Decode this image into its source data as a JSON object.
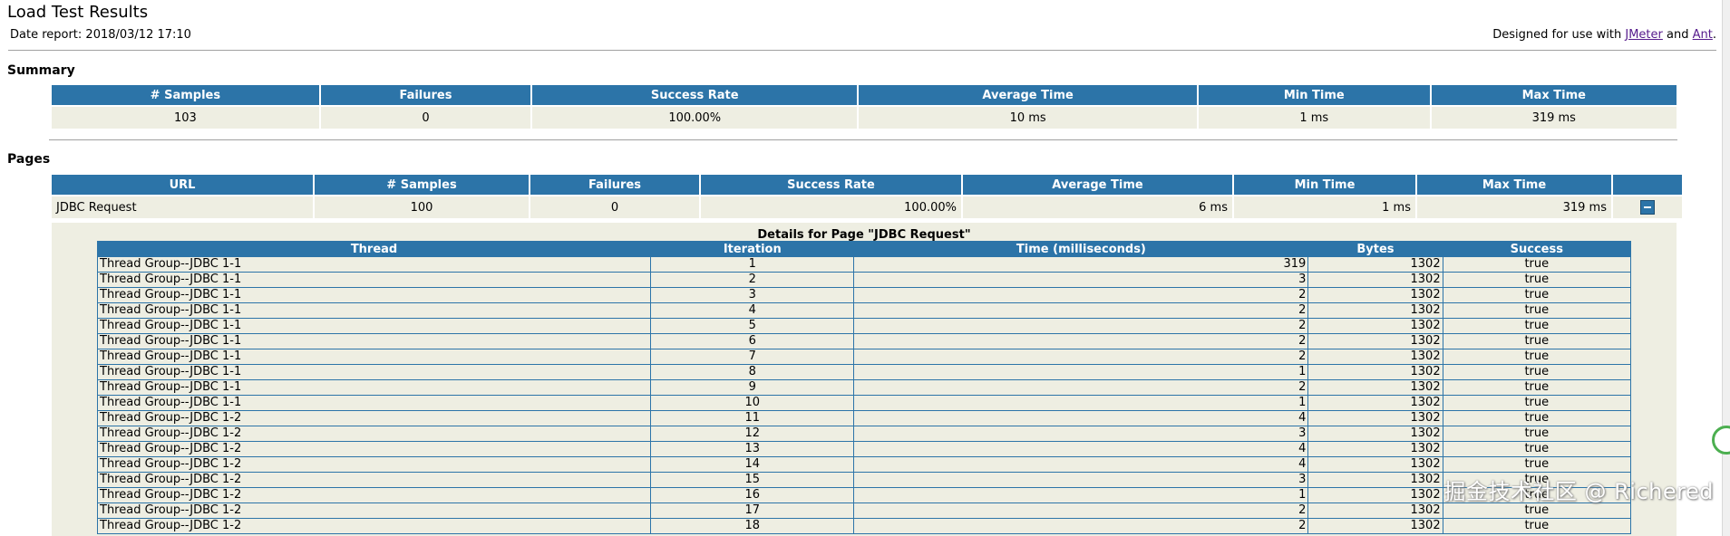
{
  "header": {
    "title": "Load Test Results",
    "date_report": "Date report: 2018/03/12 17:10",
    "designed_prefix": "Designed for use with",
    "jmeter_link": "JMeter",
    "and_text": "and",
    "ant_link": "Ant",
    "period": "."
  },
  "summary": {
    "heading": "Summary",
    "columns": [
      "# Samples",
      "Failures",
      "Success Rate",
      "Average Time",
      "Min Time",
      "Max Time"
    ],
    "row": [
      "103",
      "0",
      "100.00%",
      "10 ms",
      "1 ms",
      "319 ms"
    ]
  },
  "pages": {
    "heading": "Pages",
    "columns": [
      "URL",
      "# Samples",
      "Failures",
      "Success Rate",
      "Average Time",
      "Min Time",
      "Max Time",
      ""
    ],
    "row": {
      "url": "JDBC Request",
      "samples": "100",
      "failures": "0",
      "success_rate": "100.00%",
      "average_time": "6 ms",
      "min_time": "1 ms",
      "max_time": "319 ms"
    }
  },
  "details": {
    "caption": "Details for Page \"JDBC Request\"",
    "columns": [
      "Thread",
      "Iteration",
      "Time (milliseconds)",
      "Bytes",
      "Success"
    ],
    "rows": [
      [
        "Thread Group--JDBC 1-1",
        "1",
        "319",
        "1302",
        "true"
      ],
      [
        "Thread Group--JDBC 1-1",
        "2",
        "3",
        "1302",
        "true"
      ],
      [
        "Thread Group--JDBC 1-1",
        "3",
        "2",
        "1302",
        "true"
      ],
      [
        "Thread Group--JDBC 1-1",
        "4",
        "2",
        "1302",
        "true"
      ],
      [
        "Thread Group--JDBC 1-1",
        "5",
        "2",
        "1302",
        "true"
      ],
      [
        "Thread Group--JDBC 1-1",
        "6",
        "2",
        "1302",
        "true"
      ],
      [
        "Thread Group--JDBC 1-1",
        "7",
        "2",
        "1302",
        "true"
      ],
      [
        "Thread Group--JDBC 1-1",
        "8",
        "1",
        "1302",
        "true"
      ],
      [
        "Thread Group--JDBC 1-1",
        "9",
        "2",
        "1302",
        "true"
      ],
      [
        "Thread Group--JDBC 1-1",
        "10",
        "1",
        "1302",
        "true"
      ],
      [
        "Thread Group--JDBC 1-2",
        "11",
        "4",
        "1302",
        "true"
      ],
      [
        "Thread Group--JDBC 1-2",
        "12",
        "3",
        "1302",
        "true"
      ],
      [
        "Thread Group--JDBC 1-2",
        "13",
        "4",
        "1302",
        "true"
      ],
      [
        "Thread Group--JDBC 1-2",
        "14",
        "4",
        "1302",
        "true"
      ],
      [
        "Thread Group--JDBC 1-2",
        "15",
        "3",
        "1302",
        "true"
      ],
      [
        "Thread Group--JDBC 1-2",
        "16",
        "1",
        "1302",
        "true"
      ],
      [
        "Thread Group--JDBC 1-2",
        "17",
        "2",
        "1302",
        "true"
      ],
      [
        "Thread Group--JDBC 1-2",
        "18",
        "2",
        "1302",
        "true"
      ]
    ]
  },
  "watermark": "掘金技术社区 @ Richered",
  "colors": {
    "header_bg": "#2c74a8",
    "cell_bg": "#eeeee2",
    "link": "#551a8b"
  },
  "icons": {
    "collapse": "collapse-minus-icon"
  }
}
